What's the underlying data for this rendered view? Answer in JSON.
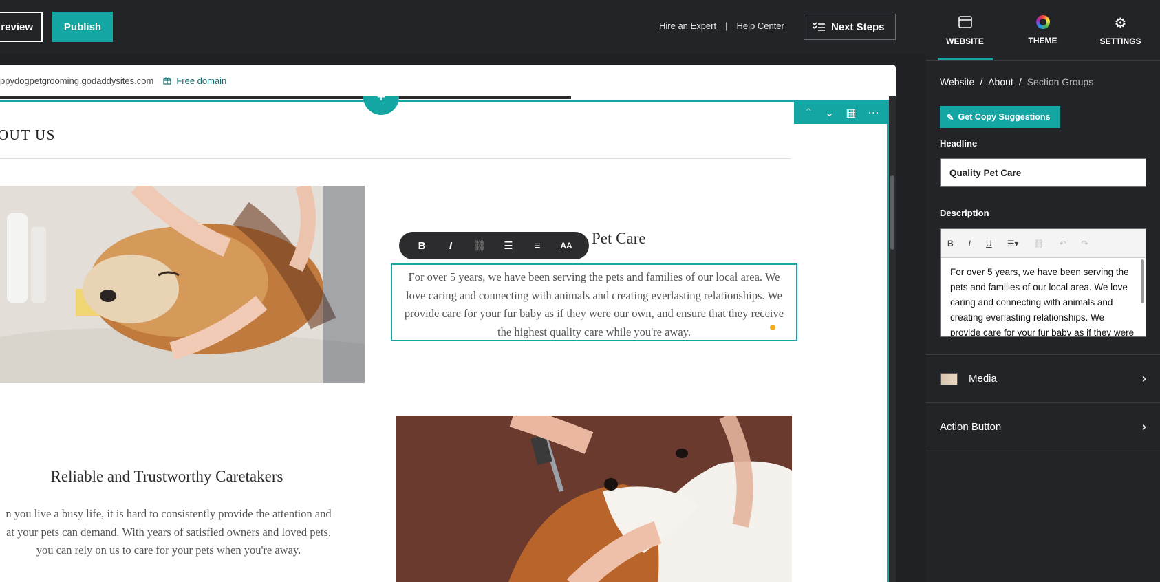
{
  "topbar": {
    "preview_label": "review",
    "publish_label": "Publish",
    "hire_expert": "Hire an Expert",
    "separator": "|",
    "help_center": "Help Center",
    "next_steps": "Next Steps"
  },
  "urlbar": {
    "url": "ppydogpetgrooming.godaddysites.com",
    "free_domain": "Free domain"
  },
  "canvas": {
    "add_icon": "+",
    "section_title": "OUT US",
    "section1": {
      "heading": "Pet Care",
      "text": "For over 5 years, we have been serving the pets and families of our local area. We love caring and connecting with animals and creating everlasting relationships. We provide care for your fur baby as if they were our own, and ensure that they receive the highest quality care while you're away."
    },
    "format_toolbar": [
      "B",
      "I",
      "🔗",
      "≔",
      "⒈",
      "AA"
    ],
    "section2": {
      "heading": "Reliable and Trustworthy Caretakers",
      "text": "n you live a busy life, it is hard to consistently provide the attention and\nat your pets can demand. With years of satisfied owners and loved pets,\nyou can rely on us to care for your pets when you're away."
    }
  },
  "panel": {
    "tabs": [
      {
        "label": "WEBSITE",
        "icon": "browser-icon"
      },
      {
        "label": "THEME",
        "icon": "theme-ring-icon"
      },
      {
        "label": "SETTINGS",
        "icon": "gear-icon"
      }
    ],
    "breadcrumb": [
      "Website",
      "/",
      "About",
      "/",
      "Section Groups"
    ],
    "copy_button": "Get Copy Suggestions",
    "headline_label": "Headline",
    "headline_value": "Quality Pet Care",
    "description_label": "Description",
    "description_value": "For over 5 years, we have been serving the pets and families of our local area. We love caring and connecting with animals and creating everlasting relationships. We provide care for your fur baby as if they were our own, and ensure that they receive the highest quality care while you're away.",
    "rows": [
      "Media",
      "Action Button"
    ]
  },
  "colors": {
    "accent": "#13a6a2",
    "dark_bg": "#222427"
  }
}
